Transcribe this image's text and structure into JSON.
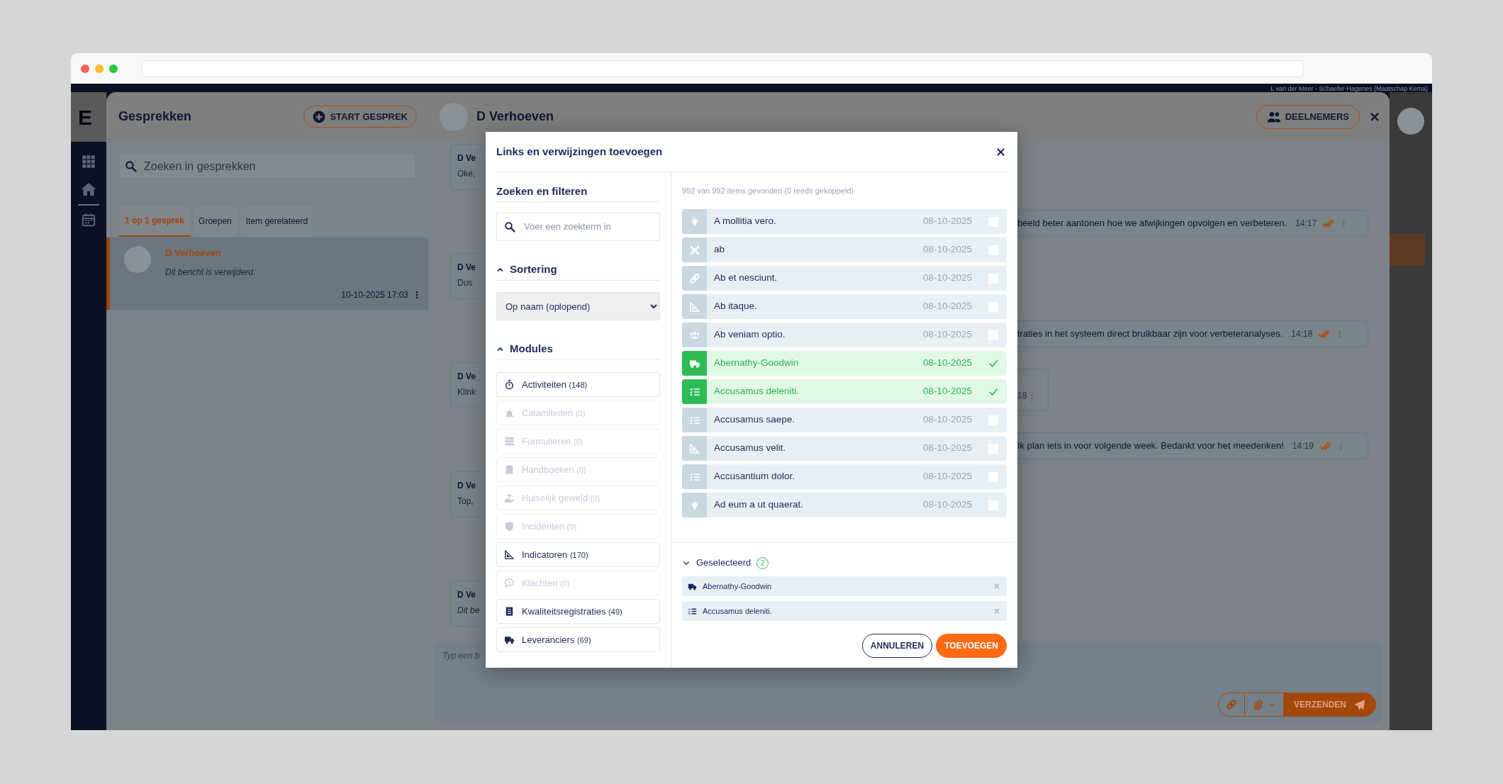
{
  "app": {
    "logo": "E",
    "account": "L van der Meer - Schaefer-Hagenes (Maatschap Kema)"
  },
  "conversations_panel": {
    "title": "Gesprekken",
    "start_button": "START GESPREK",
    "search_placeholder": "Zoeken in gesprekken",
    "tabs": [
      {
        "label": "1 op 1 gesprek",
        "selected": true
      },
      {
        "label": "Groepen",
        "selected": false
      },
      {
        "label": "Item gerelateerd",
        "selected": false
      }
    ],
    "conversations": [
      {
        "name": "D Verhoeven",
        "preview": "Dit bericht is verwijderd.",
        "time": "10-10-2025 17:03",
        "selected": true
      }
    ]
  },
  "chat": {
    "contact": "D Verhoeven",
    "participants_button": "DEELNEMERS",
    "received": [
      {
        "sender": "D Ve",
        "text": "Oké,",
        "deleted": false
      },
      {
        "sender": "D Ve",
        "text": "Dus",
        "deleted": false
      },
      {
        "sender": "D Ve",
        "text": "Klink",
        "deleted": false
      },
      {
        "sender": "D Ve",
        "text": "Top,",
        "deleted": false
      },
      {
        "sender": "D Ve",
        "text": "Dit be",
        "deleted": true
      }
    ],
    "right_side": [
      {
        "kind": "sent",
        "text": "beeld beter aantonen hoe we afwijkingen opvolgen en verbeteren.",
        "time": "14:17",
        "read": true
      },
      {
        "kind": "sent",
        "text": "traties in het systeem direct bruikbaar zijn voor verbeteranalyses.",
        "time": "14:18",
        "read": true
      },
      {
        "kind": "partial",
        "time": "18"
      },
      {
        "kind": "sent",
        "text": "Ik plan iets in voor volgende week. Bedankt voor het meedenken!",
        "time": "14:19",
        "read": true
      }
    ],
    "composer": {
      "placeholder": "Typ een b",
      "send_button": "VERZENDEN"
    }
  },
  "modal": {
    "title": "Links en verwijzingen toevoegen",
    "filter_title": "Zoeken en filteren",
    "search_placeholder": "Voer een zoekterm in",
    "sort_title": "Sortering",
    "sort_expanded": true,
    "sort_value": "Op naam (oplopend)",
    "modules_title": "Modules",
    "modules_expanded": true,
    "modules": [
      {
        "label": "Activiteiten",
        "count": "(148)",
        "disabled": false,
        "kind": "stopwatch"
      },
      {
        "label": "Calamiteiten",
        "count": "(0)",
        "disabled": true,
        "kind": "siren"
      },
      {
        "label": "Formulieren",
        "count": "(0)",
        "disabled": true,
        "kind": "table"
      },
      {
        "label": "Handboeken",
        "count": "(0)",
        "disabled": true,
        "kind": "book"
      },
      {
        "label": "Huiselijk geweld",
        "count": "(0)",
        "disabled": true,
        "kind": "hand"
      },
      {
        "label": "Incidenten",
        "count": "(0)",
        "disabled": true,
        "kind": "shield"
      },
      {
        "label": "Indicatoren",
        "count": "(170)",
        "disabled": false,
        "kind": "setsquare"
      },
      {
        "label": "Klachten",
        "count": "(0)",
        "disabled": true,
        "kind": "comment"
      },
      {
        "label": "Kwaliteitsregistraties",
        "count": "(49)",
        "disabled": false,
        "kind": "clipboard"
      },
      {
        "label": "Leveranciers",
        "count": "(69)",
        "disabled": false,
        "kind": "truck"
      }
    ],
    "result_count": "992 van 992 items gevonden (0 reeds gekoppeld)",
    "items": [
      {
        "name": "A mollitia vero.",
        "date": "08-10-2025",
        "checked": false,
        "kind": "lightbulb"
      },
      {
        "name": "ab",
        "date": "08-10-2025",
        "checked": false,
        "kind": "tools"
      },
      {
        "name": "Ab et nesciunt.",
        "date": "08-10-2025",
        "checked": false,
        "kind": "link"
      },
      {
        "name": "Ab itaque.",
        "date": "08-10-2025",
        "checked": false,
        "kind": "setsquare"
      },
      {
        "name": "Ab veniam optio.",
        "date": "08-10-2025",
        "checked": false,
        "kind": "people"
      },
      {
        "name": "Abernathy-Goodwin",
        "date": "08-10-2025",
        "checked": true,
        "kind": "truck"
      },
      {
        "name": "Accusamus deleniti.",
        "date": "08-10-2025",
        "checked": true,
        "kind": "checklist"
      },
      {
        "name": "Accusamus saepe.",
        "date": "08-10-2025",
        "checked": false,
        "kind": "checklist"
      },
      {
        "name": "Accusamus velit.",
        "date": "08-10-2025",
        "checked": false,
        "kind": "setsquare"
      },
      {
        "name": "Accusantium dolor.",
        "date": "08-10-2025",
        "checked": false,
        "kind": "checklist"
      },
      {
        "name": "Ad eum a ut quaerat.",
        "date": "08-10-2025",
        "checked": false,
        "kind": "lightbulb"
      }
    ],
    "selected_title": "Geselecteerd",
    "selected_count": "2",
    "selected_expanded": true,
    "selected_items": [
      {
        "name": "Abernathy-Goodwin",
        "kind": "truck"
      },
      {
        "name": "Accusamus deleniti.",
        "kind": "checklist"
      }
    ],
    "cancel_button": "ANNULEREN",
    "add_button": "TOEVOEGEN"
  }
}
